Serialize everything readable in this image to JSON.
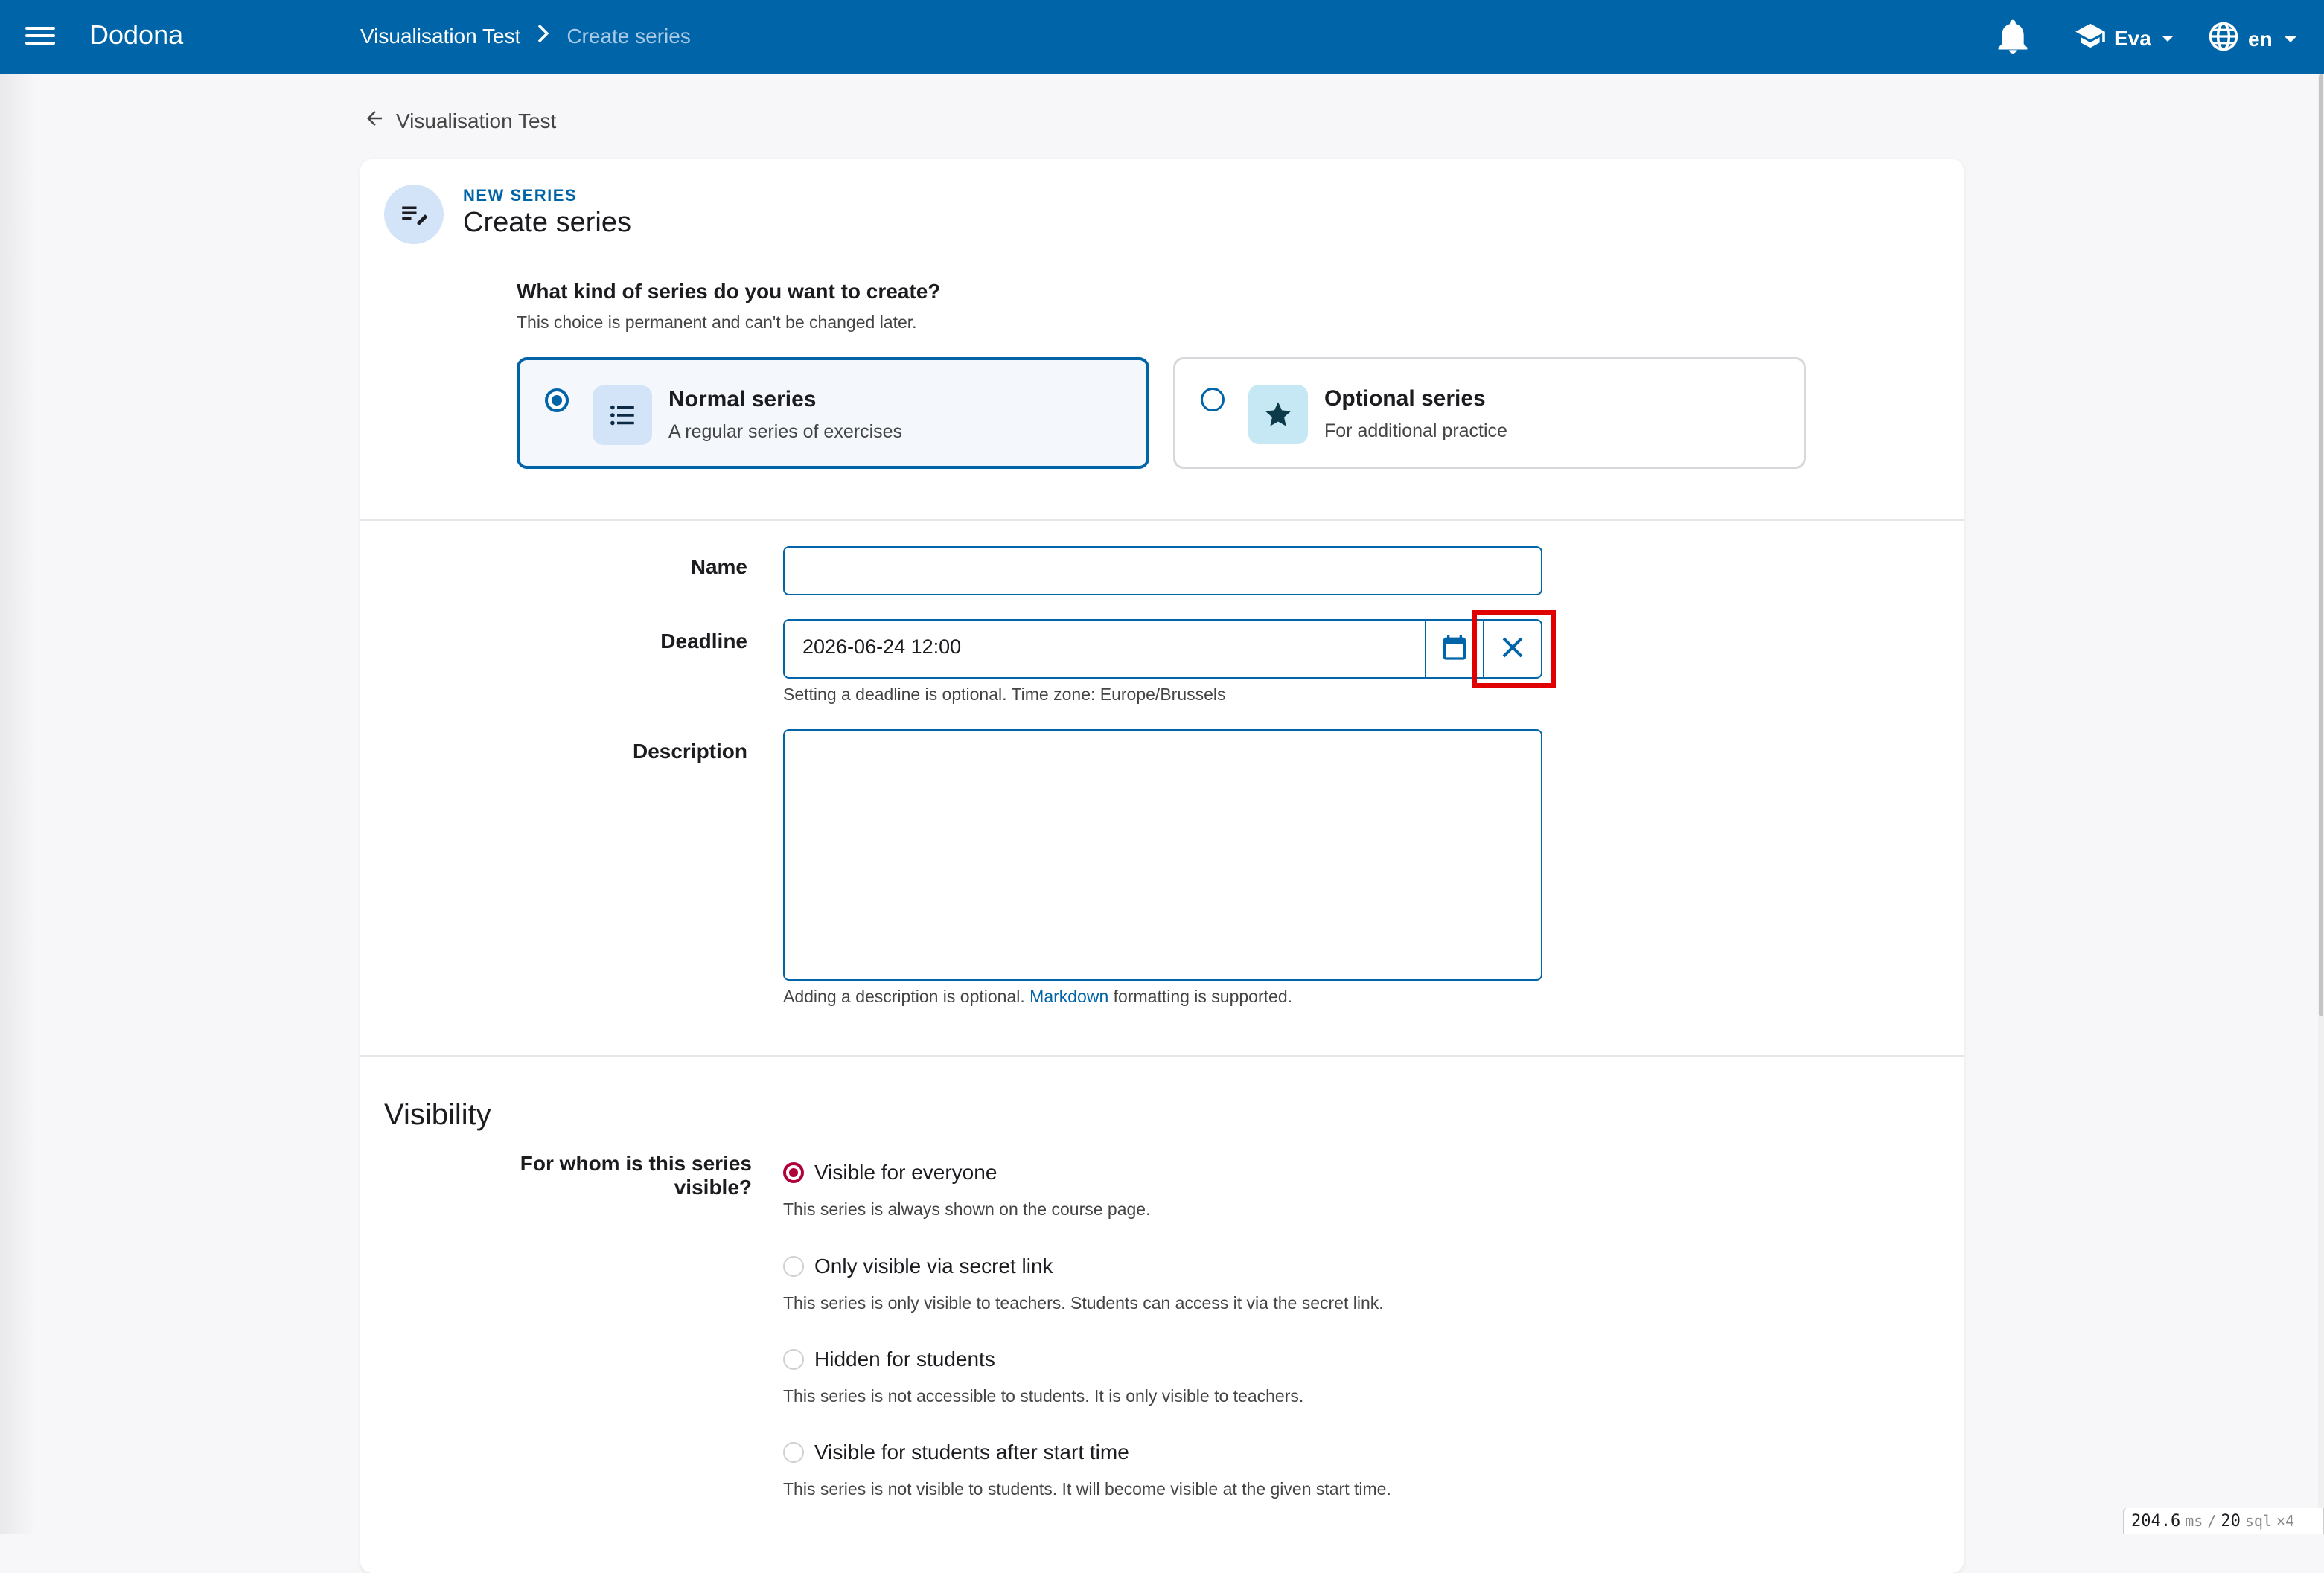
{
  "app": {
    "brand": "Dodona",
    "breadcrumb": [
      "Visualisation Test",
      "Create series"
    ],
    "user": "Eva",
    "language": "en"
  },
  "back_link": "Visualisation Test",
  "card": {
    "overline": "NEW SERIES",
    "title": "Create series",
    "kind_question": "What kind of series do you want to create?",
    "kind_subtitle": "This choice is permanent and can't be changed later.",
    "options": [
      {
        "title": "Normal series",
        "description": "A regular series of exercises",
        "selected": true,
        "icon": "list-icon"
      },
      {
        "title": "Optional series",
        "description": "For additional practice",
        "selected": false,
        "icon": "star-icon"
      }
    ]
  },
  "form": {
    "name_label": "Name",
    "name_value": "",
    "deadline_label": "Deadline",
    "deadline_value": "2026-06-24 12:00",
    "deadline_help": "Setting a deadline is optional. Time zone: Europe/Brussels",
    "description_label": "Description",
    "description_value": "",
    "description_help_prefix": "Adding a description is optional. ",
    "description_help_link": "Markdown",
    "description_help_suffix": " formatting is supported."
  },
  "visibility": {
    "section_title": "Visibility",
    "question": "For whom is this series visible?",
    "options": [
      {
        "label": "Visible for everyone",
        "help": "This series is always shown on the course page.",
        "selected": true
      },
      {
        "label": "Only visible via secret link",
        "help": "This series is only visible to teachers. Students can access it via the secret link.",
        "selected": false
      },
      {
        "label": "Hidden for students",
        "help": "This series is not accessible to students. It is only visible to teachers.",
        "selected": false
      },
      {
        "label": "Visible for students after start time",
        "help": "This series is not visible to students. It will become visible at the given start time.",
        "selected": false
      }
    ]
  },
  "perf": {
    "ms": "204.6",
    "ms_unit": "ms",
    "sep": "/",
    "sql": "20",
    "sql_unit": "sql",
    "mult": "×4"
  },
  "colors": {
    "primary": "#0064a8",
    "accent": "#b0003a",
    "highlight": "#e00000"
  }
}
